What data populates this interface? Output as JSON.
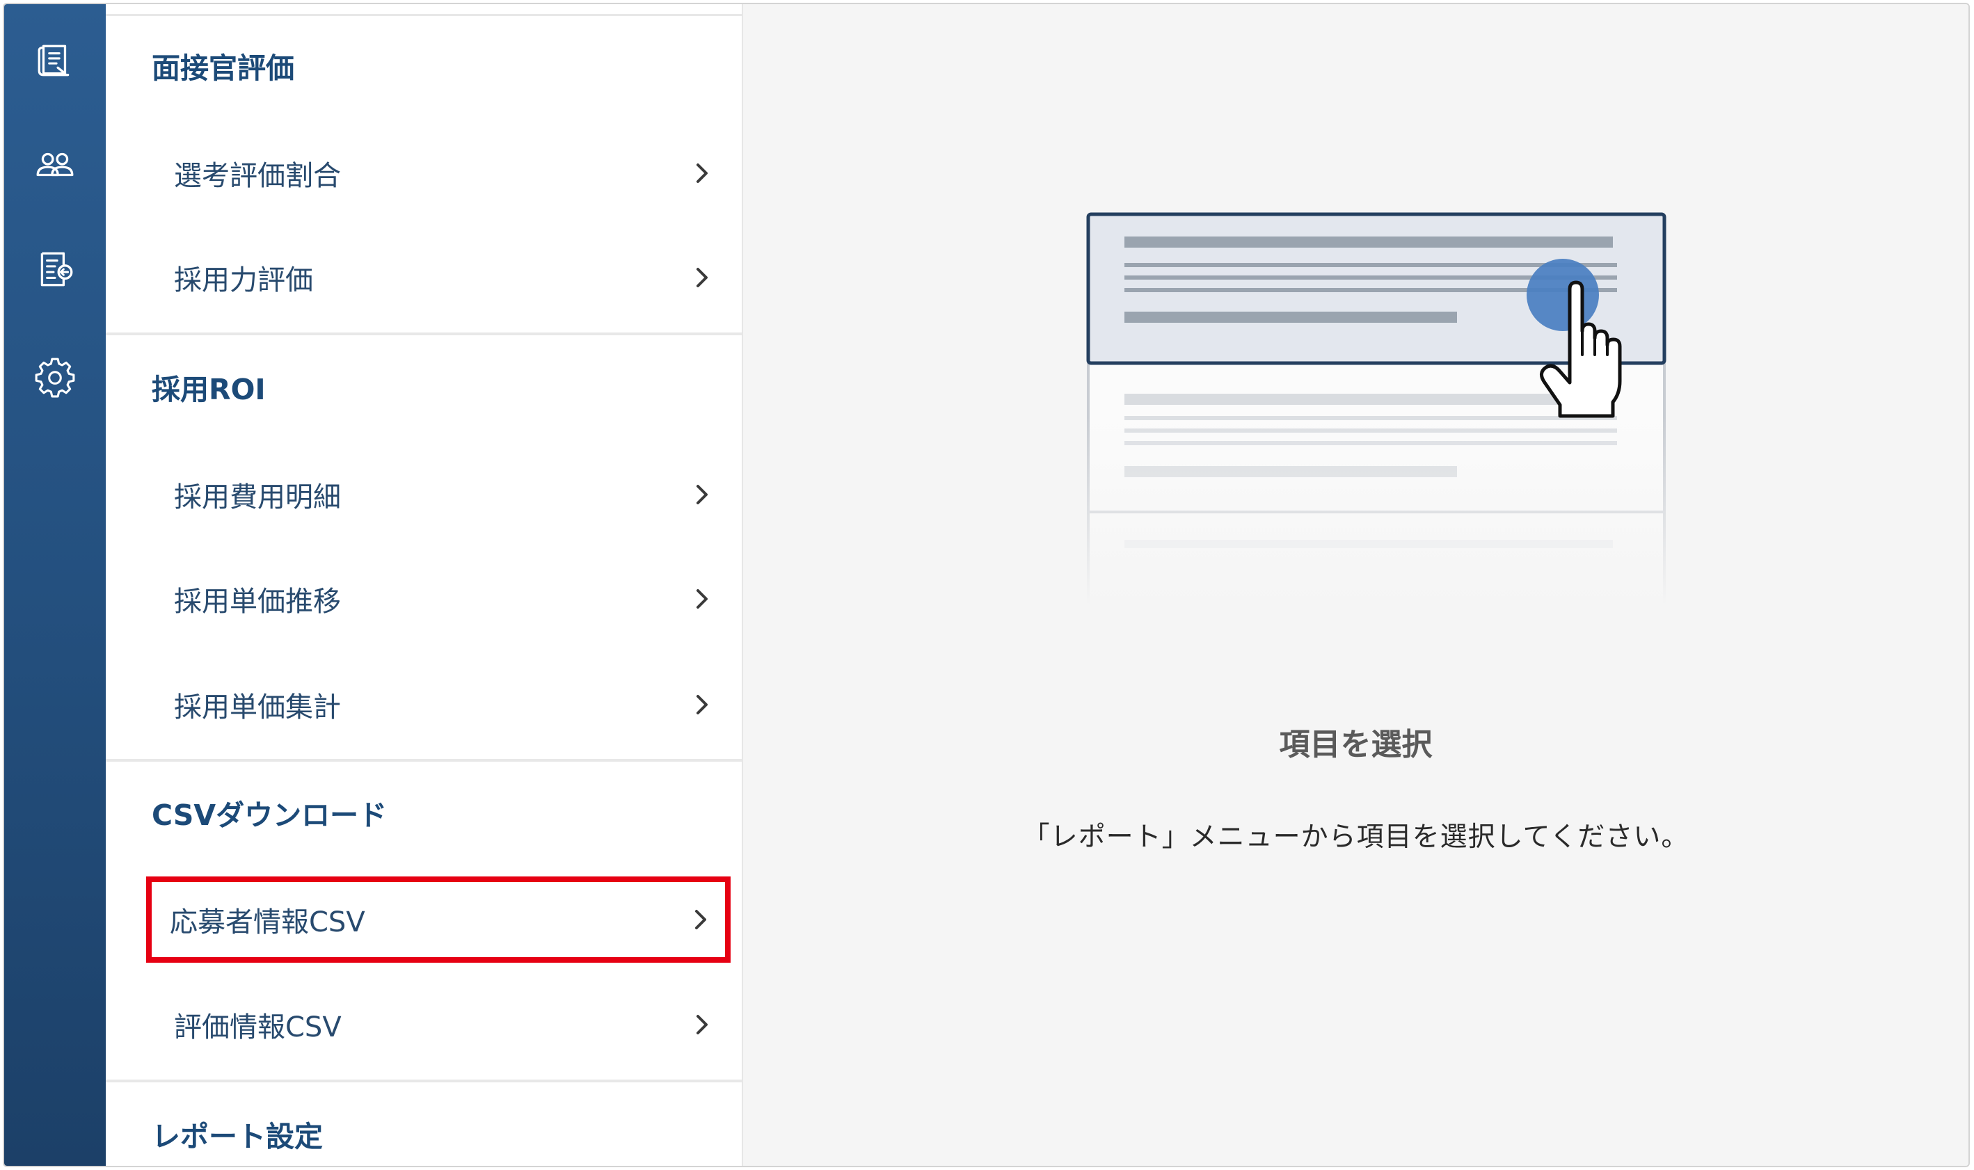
{
  "rail": {
    "items": [
      {
        "name": "report-icon"
      },
      {
        "name": "users-icon"
      },
      {
        "name": "form-icon"
      },
      {
        "name": "gear-icon"
      }
    ]
  },
  "menu": {
    "sections": [
      {
        "title": "面接官評価",
        "items": [
          {
            "label": "選考評価割合"
          },
          {
            "label": "採用力評価"
          }
        ]
      },
      {
        "title": "採用ROI",
        "items": [
          {
            "label": "採用費用明細"
          },
          {
            "label": "採用単価推移"
          },
          {
            "label": "採用単価集計"
          }
        ]
      },
      {
        "title": "CSVダウンロード",
        "items": [
          {
            "label": "応募者情報CSV"
          },
          {
            "label": "評価情報CSV"
          }
        ]
      },
      {
        "title": "レポート設定",
        "items": []
      }
    ]
  },
  "content": {
    "empty_title": "項目を選択",
    "empty_description": "「レポート」メニューから項目を選択してください。"
  },
  "colors": {
    "rail_top": "#2c5d91",
    "rail_bottom": "#1c4068",
    "section_title": "#1c4a78",
    "item_text": "#284a6e",
    "highlight_border": "#e60012",
    "illustration_accent": "#4a7fc1"
  }
}
